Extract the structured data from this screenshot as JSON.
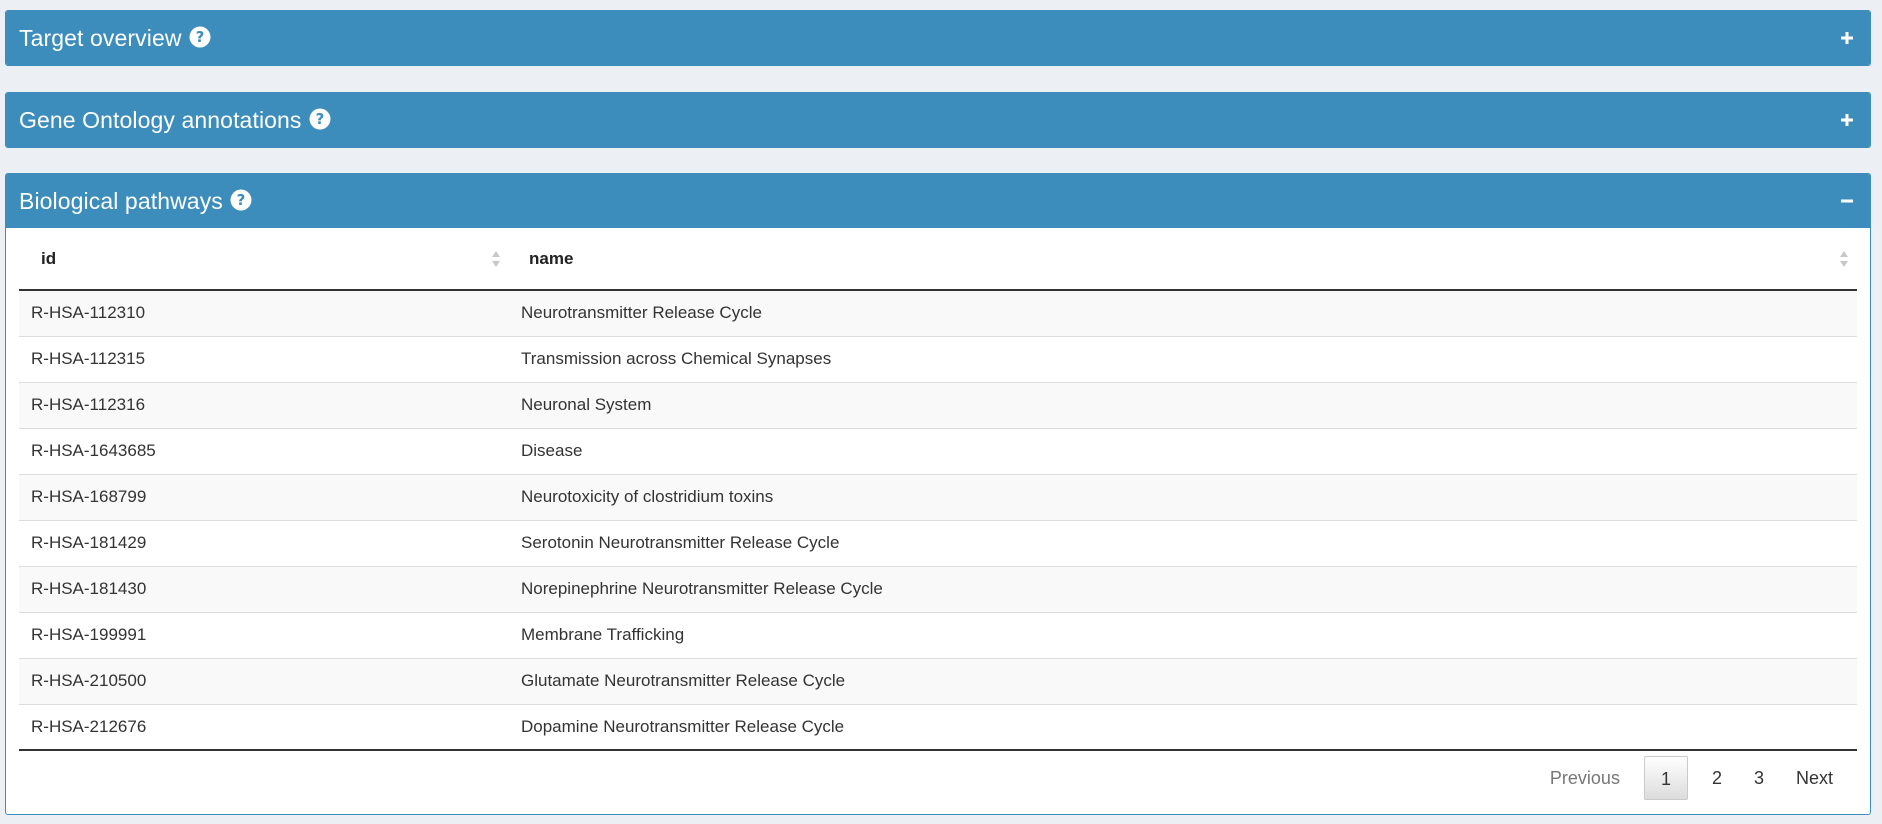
{
  "panels": {
    "target_overview": {
      "title": "Target overview",
      "toggle": "plus-icon"
    },
    "gene_ontology": {
      "title": "Gene Ontology annotations",
      "toggle": "plus-icon"
    },
    "biological_pathways": {
      "title": "Biological pathways",
      "toggle": "minus-icon"
    }
  },
  "table": {
    "columns": [
      "id",
      "name"
    ],
    "rows": [
      {
        "id": "R-HSA-112310",
        "name": "Neurotransmitter Release Cycle"
      },
      {
        "id": "R-HSA-112315",
        "name": "Transmission across Chemical Synapses"
      },
      {
        "id": "R-HSA-112316",
        "name": "Neuronal System"
      },
      {
        "id": "R-HSA-1643685",
        "name": "Disease"
      },
      {
        "id": "R-HSA-168799",
        "name": "Neurotoxicity of clostridium toxins"
      },
      {
        "id": "R-HSA-181429",
        "name": "Serotonin Neurotransmitter Release Cycle"
      },
      {
        "id": "R-HSA-181430",
        "name": "Norepinephrine Neurotransmitter Release Cycle"
      },
      {
        "id": "R-HSA-199991",
        "name": "Membrane Trafficking"
      },
      {
        "id": "R-HSA-210500",
        "name": "Glutamate Neurotransmitter Release Cycle"
      },
      {
        "id": "R-HSA-212676",
        "name": "Dopamine Neurotransmitter Release Cycle"
      }
    ]
  },
  "pagination": {
    "previous": "Previous",
    "pages": [
      "1",
      "2",
      "3"
    ],
    "current": "1",
    "next": "Next"
  },
  "colors": {
    "header_blue": "#3c8dbc",
    "page_background": "#ecf0f5"
  }
}
